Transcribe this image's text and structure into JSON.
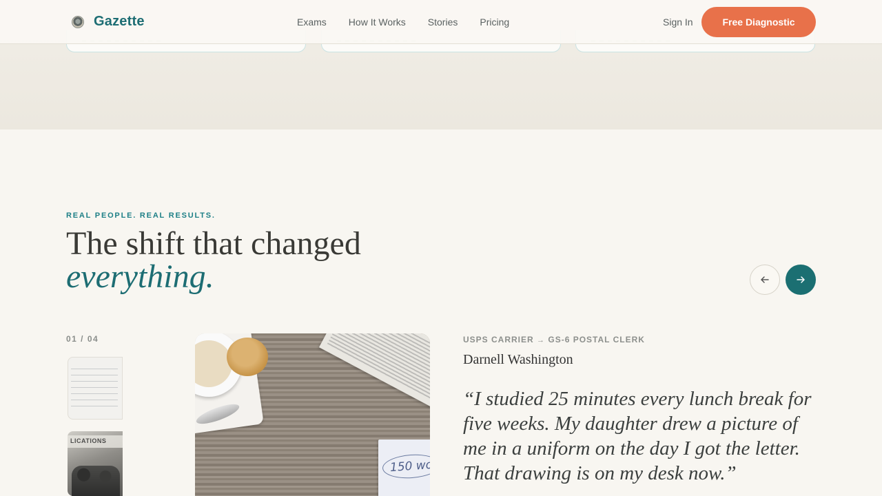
{
  "header": {
    "brand": "Gazette",
    "nav": [
      "Exams",
      "How It Works",
      "Stories",
      "Pricing"
    ],
    "sign_in": "Sign In",
    "cta": "Free Diagnostic"
  },
  "section": {
    "eyebrow": "REAL PEOPLE. REAL RESULTS.",
    "headline": "The shift that changed",
    "headline_accent": "everything.",
    "counter": "01 / 04",
    "prev_icon": "arrow-left-icon",
    "next_icon": "arrow-right-icon"
  },
  "story": {
    "role_from": "USPS CARRIER",
    "role_arrow": "→",
    "role_to": "GS-6 POSTAL CLERK",
    "name": "Darnell Washington",
    "quote": "“I studied 25 minutes every lunch break for five weeks. My daughter drew a picture of me in a uniform on the day I got the letter. That drawing is on my desk now.”",
    "photo_note": "150 wo",
    "thumb_2_sign": "LICATIONS"
  },
  "colors": {
    "brand_teal": "#1d6d73",
    "cta_orange": "#e8714a",
    "background": "#f8f6f1"
  }
}
